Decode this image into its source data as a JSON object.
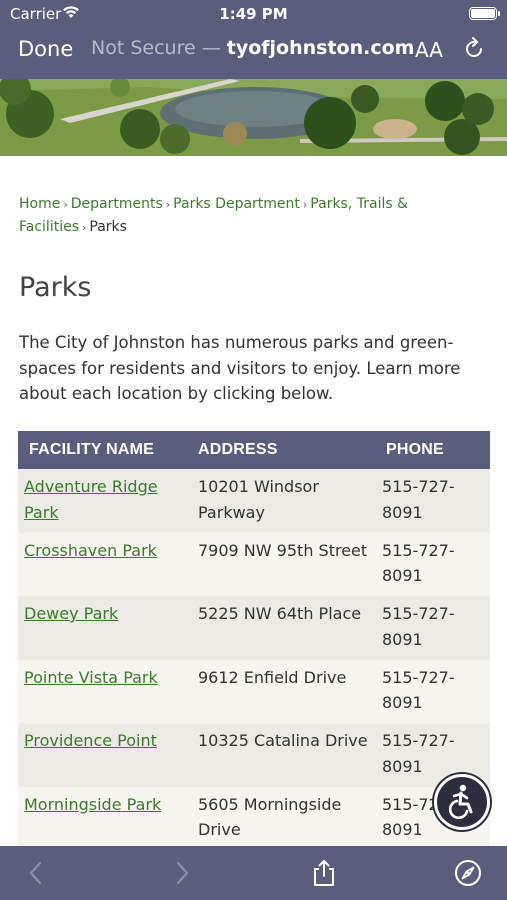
{
  "status": {
    "carrier": "Carrier",
    "time": "1:49 PM"
  },
  "browser": {
    "done_label": "Done",
    "security_label": "Not Secure — ",
    "url_host": "tyofjohnston.com",
    "text_size_label": "AA"
  },
  "breadcrumb": {
    "items": [
      "Home",
      "Departments",
      "Parks Department",
      "Parks, Trails & Facilities"
    ],
    "current": "Parks"
  },
  "page": {
    "title": "Parks",
    "intro": "The City of Johnston has numerous parks and green-spaces for residents and visitors to enjoy. Learn more about each location by clicking below."
  },
  "table": {
    "headers": [
      "FACILITY NAME",
      "ADDRESS",
      "PHONE"
    ],
    "rows": [
      {
        "name": "Adventure Ridge Park",
        "address": "10201 Windsor Parkway",
        "phone": "515-727-8091"
      },
      {
        "name": "Crosshaven Park",
        "address": "7909 NW 95th Street",
        "phone": "515-727-8091"
      },
      {
        "name": "Dewey Park",
        "address": "5225 NW 64th Place",
        "phone": "515-727-8091"
      },
      {
        "name": "Pointe Vista Park",
        "address": "9612 Enfield Drive",
        "phone": "515-727-8091"
      },
      {
        "name": "Providence Point",
        "address": "10325 Catalina Drive",
        "phone": "515-727-8091"
      },
      {
        "name": "Morningside Park",
        "address": "5605 Morningside Drive",
        "phone": "515-727-8091"
      }
    ]
  },
  "toolbar": {
    "icons": [
      "back-icon",
      "forward-icon",
      "share-icon",
      "compass-icon"
    ]
  },
  "colors": {
    "chrome": "#5b5d7d",
    "link": "#3e7a2e",
    "row_odd": "#ebeae5",
    "row_even": "#f7f5f0"
  }
}
